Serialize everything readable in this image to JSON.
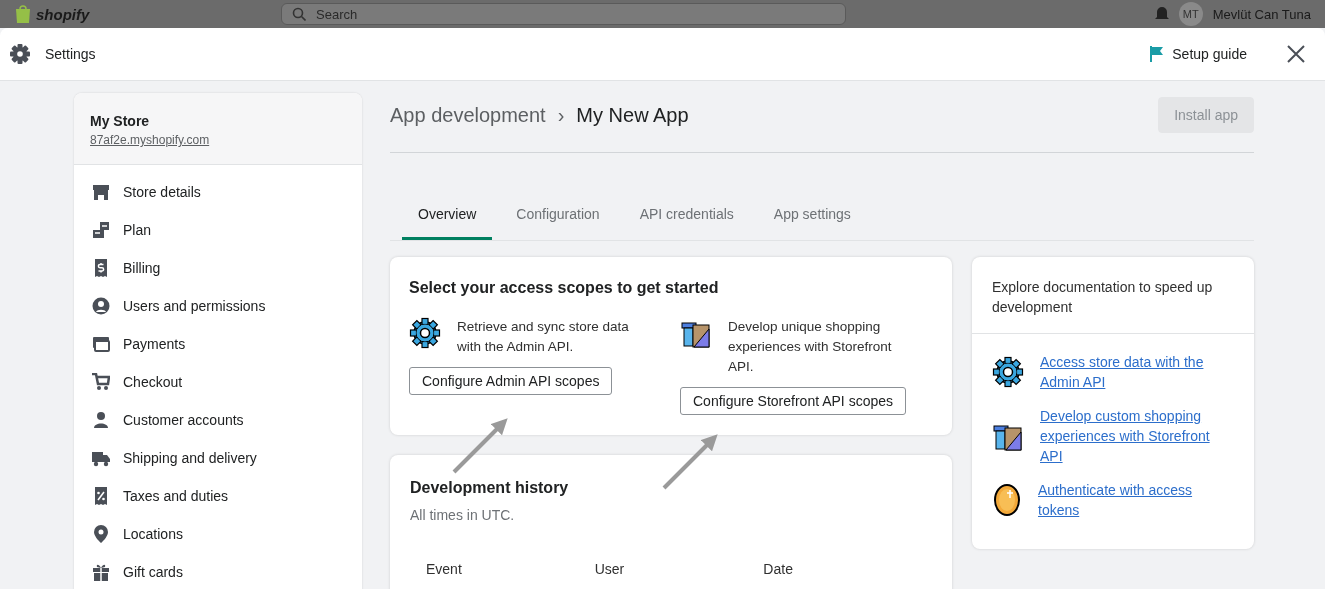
{
  "app_bar": {
    "logo": "shopify",
    "search": {
      "placeholder": "Search"
    },
    "user": {
      "initials": "MT",
      "name": "Mevlüt Can Tuna"
    }
  },
  "window": {
    "title": "Settings",
    "setup_guide": "Setup guide"
  },
  "sidebar": {
    "store_name": "My Store",
    "store_domain": "87af2e.myshopify.com",
    "items": [
      {
        "label": "Store details",
        "selected": false
      },
      {
        "label": "Plan",
        "selected": false
      },
      {
        "label": "Billing",
        "selected": false
      },
      {
        "label": "Users and permissions",
        "selected": false
      },
      {
        "label": "Payments",
        "selected": false
      },
      {
        "label": "Checkout",
        "selected": false
      },
      {
        "label": "Customer accounts",
        "selected": false
      },
      {
        "label": "Shipping and delivery",
        "selected": false
      },
      {
        "label": "Taxes and duties",
        "selected": false
      },
      {
        "label": "Locations",
        "selected": false
      },
      {
        "label": "Gift cards",
        "selected": false
      }
    ]
  },
  "breadcrumb": {
    "parent": "App development",
    "separator": "›",
    "current": "My New App"
  },
  "install_button": {
    "label": "Install app",
    "disabled": true
  },
  "tabs": [
    {
      "label": "Overview",
      "selected": true
    },
    {
      "label": "Configuration",
      "selected": false
    },
    {
      "label": "API credentials",
      "selected": false
    },
    {
      "label": "App settings",
      "selected": false
    }
  ],
  "scopes_card": {
    "title": "Select your access scopes to get started",
    "options": [
      {
        "kind": "gear",
        "text": "Retrieve and sync store data with the Admin API.",
        "button": "Configure Admin API scopes"
      },
      {
        "kind": "tools",
        "text": "Develop unique shopping experiences with Storefront API.",
        "button": "Configure Storefront API scopes"
      }
    ]
  },
  "history_card": {
    "title": "Development history",
    "subtitle": "All times in UTC.",
    "columns": [
      "Event",
      "User",
      "Date"
    ]
  },
  "docs_card": {
    "title": "Explore documentation to speed up development",
    "links": [
      {
        "kind": "gear",
        "label": "Access store data with the Admin API"
      },
      {
        "kind": "tools",
        "label": "Develop custom shopping experiences with Storefront API"
      },
      {
        "kind": "coin",
        "label": "Authenticate with access tokens"
      }
    ]
  }
}
